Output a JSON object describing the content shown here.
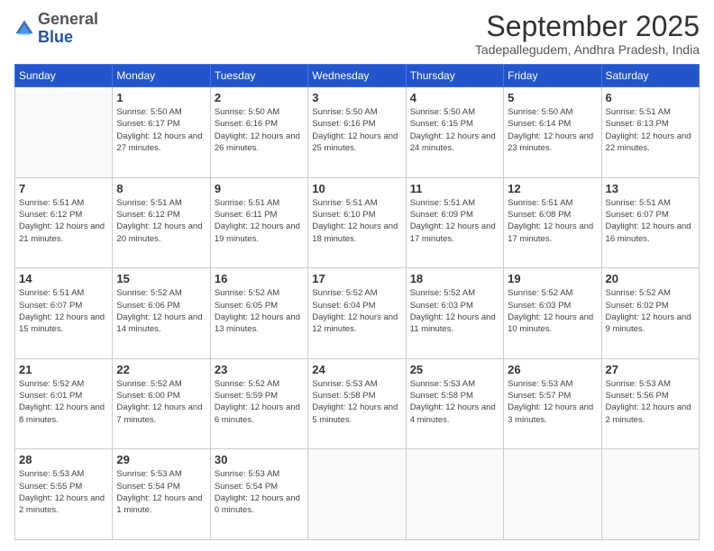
{
  "logo": {
    "general": "General",
    "blue": "Blue"
  },
  "header": {
    "month": "September 2025",
    "location": "Tadepallegudem, Andhra Pradesh, India"
  },
  "weekdays": [
    "Sunday",
    "Monday",
    "Tuesday",
    "Wednesday",
    "Thursday",
    "Friday",
    "Saturday"
  ],
  "weeks": [
    [
      {
        "day": "",
        "info": ""
      },
      {
        "day": "1",
        "info": "Sunrise: 5:50 AM\nSunset: 6:17 PM\nDaylight: 12 hours\nand 27 minutes."
      },
      {
        "day": "2",
        "info": "Sunrise: 5:50 AM\nSunset: 6:16 PM\nDaylight: 12 hours\nand 26 minutes."
      },
      {
        "day": "3",
        "info": "Sunrise: 5:50 AM\nSunset: 6:16 PM\nDaylight: 12 hours\nand 25 minutes."
      },
      {
        "day": "4",
        "info": "Sunrise: 5:50 AM\nSunset: 6:15 PM\nDaylight: 12 hours\nand 24 minutes."
      },
      {
        "day": "5",
        "info": "Sunrise: 5:50 AM\nSunset: 6:14 PM\nDaylight: 12 hours\nand 23 minutes."
      },
      {
        "day": "6",
        "info": "Sunrise: 5:51 AM\nSunset: 6:13 PM\nDaylight: 12 hours\nand 22 minutes."
      }
    ],
    [
      {
        "day": "7",
        "info": "Sunrise: 5:51 AM\nSunset: 6:12 PM\nDaylight: 12 hours\nand 21 minutes."
      },
      {
        "day": "8",
        "info": "Sunrise: 5:51 AM\nSunset: 6:12 PM\nDaylight: 12 hours\nand 20 minutes."
      },
      {
        "day": "9",
        "info": "Sunrise: 5:51 AM\nSunset: 6:11 PM\nDaylight: 12 hours\nand 19 minutes."
      },
      {
        "day": "10",
        "info": "Sunrise: 5:51 AM\nSunset: 6:10 PM\nDaylight: 12 hours\nand 18 minutes."
      },
      {
        "day": "11",
        "info": "Sunrise: 5:51 AM\nSunset: 6:09 PM\nDaylight: 12 hours\nand 17 minutes."
      },
      {
        "day": "12",
        "info": "Sunrise: 5:51 AM\nSunset: 6:08 PM\nDaylight: 12 hours\nand 17 minutes."
      },
      {
        "day": "13",
        "info": "Sunrise: 5:51 AM\nSunset: 6:07 PM\nDaylight: 12 hours\nand 16 minutes."
      }
    ],
    [
      {
        "day": "14",
        "info": "Sunrise: 5:51 AM\nSunset: 6:07 PM\nDaylight: 12 hours\nand 15 minutes."
      },
      {
        "day": "15",
        "info": "Sunrise: 5:52 AM\nSunset: 6:06 PM\nDaylight: 12 hours\nand 14 minutes."
      },
      {
        "day": "16",
        "info": "Sunrise: 5:52 AM\nSunset: 6:05 PM\nDaylight: 12 hours\nand 13 minutes."
      },
      {
        "day": "17",
        "info": "Sunrise: 5:52 AM\nSunset: 6:04 PM\nDaylight: 12 hours\nand 12 minutes."
      },
      {
        "day": "18",
        "info": "Sunrise: 5:52 AM\nSunset: 6:03 PM\nDaylight: 12 hours\nand 11 minutes."
      },
      {
        "day": "19",
        "info": "Sunrise: 5:52 AM\nSunset: 6:03 PM\nDaylight: 12 hours\nand 10 minutes."
      },
      {
        "day": "20",
        "info": "Sunrise: 5:52 AM\nSunset: 6:02 PM\nDaylight: 12 hours\nand 9 minutes."
      }
    ],
    [
      {
        "day": "21",
        "info": "Sunrise: 5:52 AM\nSunset: 6:01 PM\nDaylight: 12 hours\nand 8 minutes."
      },
      {
        "day": "22",
        "info": "Sunrise: 5:52 AM\nSunset: 6:00 PM\nDaylight: 12 hours\nand 7 minutes."
      },
      {
        "day": "23",
        "info": "Sunrise: 5:52 AM\nSunset: 5:59 PM\nDaylight: 12 hours\nand 6 minutes."
      },
      {
        "day": "24",
        "info": "Sunrise: 5:53 AM\nSunset: 5:58 PM\nDaylight: 12 hours\nand 5 minutes."
      },
      {
        "day": "25",
        "info": "Sunrise: 5:53 AM\nSunset: 5:58 PM\nDaylight: 12 hours\nand 4 minutes."
      },
      {
        "day": "26",
        "info": "Sunrise: 5:53 AM\nSunset: 5:57 PM\nDaylight: 12 hours\nand 3 minutes."
      },
      {
        "day": "27",
        "info": "Sunrise: 5:53 AM\nSunset: 5:56 PM\nDaylight: 12 hours\nand 2 minutes."
      }
    ],
    [
      {
        "day": "28",
        "info": "Sunrise: 5:53 AM\nSunset: 5:55 PM\nDaylight: 12 hours\nand 2 minutes."
      },
      {
        "day": "29",
        "info": "Sunrise: 5:53 AM\nSunset: 5:54 PM\nDaylight: 12 hours\nand 1 minute."
      },
      {
        "day": "30",
        "info": "Sunrise: 5:53 AM\nSunset: 5:54 PM\nDaylight: 12 hours\nand 0 minutes."
      },
      {
        "day": "",
        "info": ""
      },
      {
        "day": "",
        "info": ""
      },
      {
        "day": "",
        "info": ""
      },
      {
        "day": "",
        "info": ""
      }
    ]
  ]
}
